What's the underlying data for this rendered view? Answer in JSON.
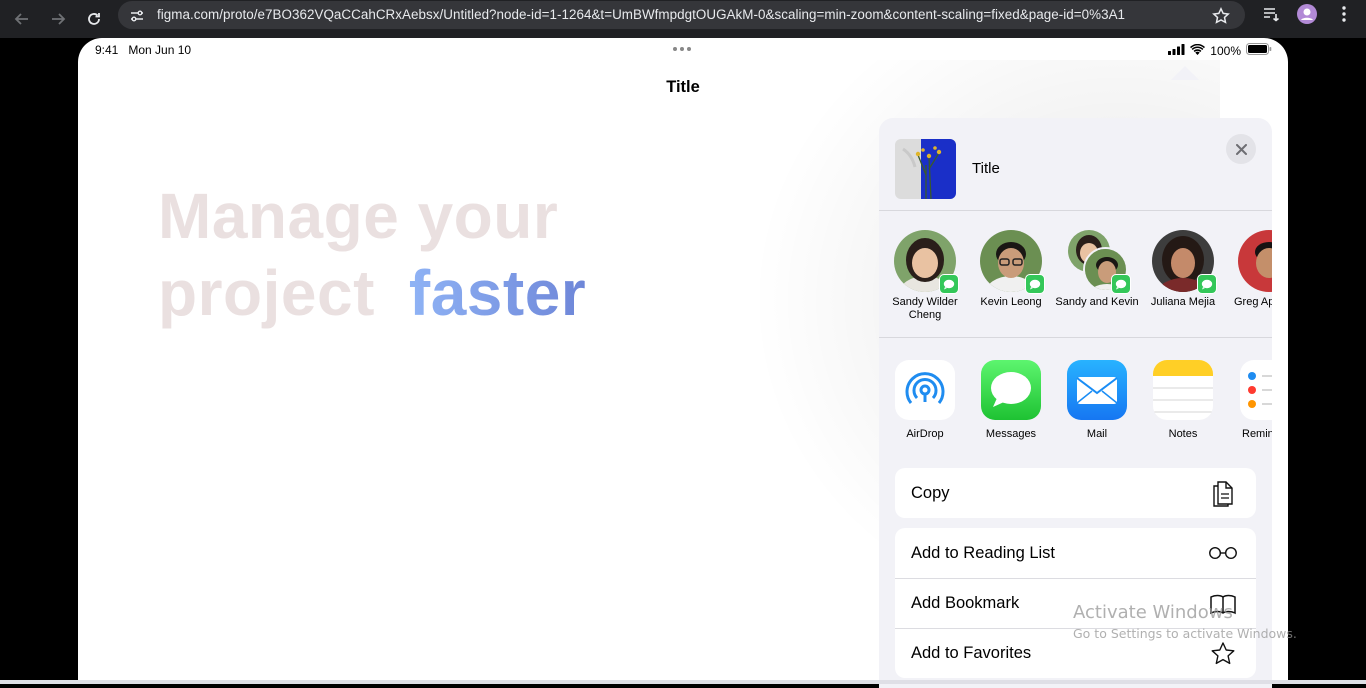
{
  "browser": {
    "url": "figma.com/proto/e7BO362VQaCCahCRxAebsx/Untitled?node-id=1-1264&t=UmBWfmpdgtOUGAkM-0&scaling=min-zoom&content-scaling=fixed&page-id=0%3A1"
  },
  "status_bar": {
    "time": "9:41",
    "date": "Mon Jun 10",
    "battery": "100%"
  },
  "page": {
    "nav_title": "Title",
    "hero_line1": "Manage your",
    "hero_line2_plain": "project",
    "hero_line2_accent": "faster"
  },
  "share_sheet": {
    "title": "Title",
    "people": [
      {
        "name": "Sandy Wilder Cheng"
      },
      {
        "name": "Kevin Leong"
      },
      {
        "name": "Sandy and Kevin"
      },
      {
        "name": "Juliana Mejia"
      },
      {
        "name": "Greg Ap"
      }
    ],
    "apps": [
      {
        "label": "AirDrop"
      },
      {
        "label": "Messages"
      },
      {
        "label": "Mail"
      },
      {
        "label": "Notes"
      },
      {
        "label": "Remin"
      }
    ],
    "actions_primary": [
      {
        "label": "Copy",
        "icon": "copy-icon"
      }
    ],
    "actions_secondary": [
      {
        "label": "Add to Reading List",
        "icon": "glasses-icon"
      },
      {
        "label": "Add Bookmark",
        "icon": "book-icon"
      },
      {
        "label": "Add to Favorites",
        "icon": "star-icon"
      }
    ]
  },
  "watermark": {
    "line1": "Activate Windows",
    "line2": "Go to Settings to activate Windows."
  },
  "colors": {
    "sheet_bg": "#f2f2f7",
    "accent_gradient_start": "#8fb3f5",
    "accent_gradient_end": "#6e86d8",
    "message_green": "#34c759",
    "hero_muted": "#eae0e0"
  }
}
